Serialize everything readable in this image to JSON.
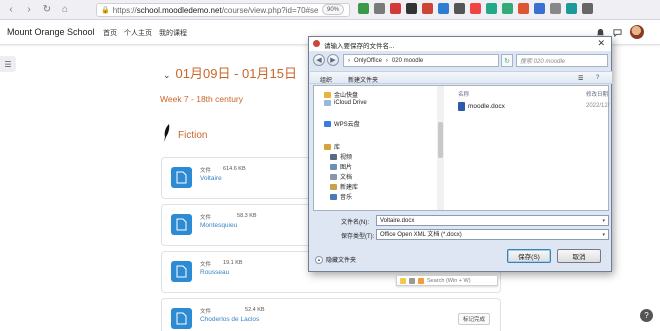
{
  "browser": {
    "url_scheme": "https://",
    "url_host": "school.moodledemo.net",
    "url_path": "/course/view.php?id=70#se",
    "zoom": "90%"
  },
  "navbar": {
    "site_name": "Mount Orange School",
    "links": [
      "首页",
      "个人主页",
      "我的课程"
    ]
  },
  "course": {
    "week_title": "01月09日 - 01月15日",
    "week_subtitle": "Week 7 - 18th century",
    "section_title": "Fiction",
    "activities": [
      {
        "type": "文件",
        "size": "614.6 KB",
        "name": "Voltaire",
        "done": ""
      },
      {
        "type": "文件",
        "size": "58.3 KB",
        "name": "Montesquieu",
        "done": ""
      },
      {
        "type": "文件",
        "size": "19.1 KB",
        "name": "Rousseau",
        "done": ""
      },
      {
        "type": "文件",
        "size": "52.4 KB",
        "name": "Choderlos de Laclos",
        "done": "标记完成"
      }
    ]
  },
  "dialog": {
    "title": "请输入要保存的文件名...",
    "path_parts": [
      "OnlyOffice",
      "020 moodle"
    ],
    "search_placeholder": "搜索 020 moodle",
    "toolbar_organize": "组织",
    "toolbar_new_folder": "新建文件夹",
    "tree_items": [
      "金山快盘",
      "iCloud Drive",
      "WPS云盘",
      "库",
      "视频",
      "图片",
      "文档",
      "新建库",
      "音乐"
    ],
    "col_name": "名称",
    "col_date": "修改日期",
    "file_name_listed": "moodle.docx",
    "file_date": "2022/12/",
    "filename_label": "文件名(N):",
    "filename_value": "Voltaire.docx",
    "filetype_label": "保存类型(T):",
    "filetype_value": "Office Open XML 文档 (*.docx)",
    "hide_folders": "隐藏文件夹",
    "save_button": "保存(S)",
    "cancel_button": "取消"
  },
  "mini_bar": {
    "search_text": "Search (Win + W)"
  }
}
